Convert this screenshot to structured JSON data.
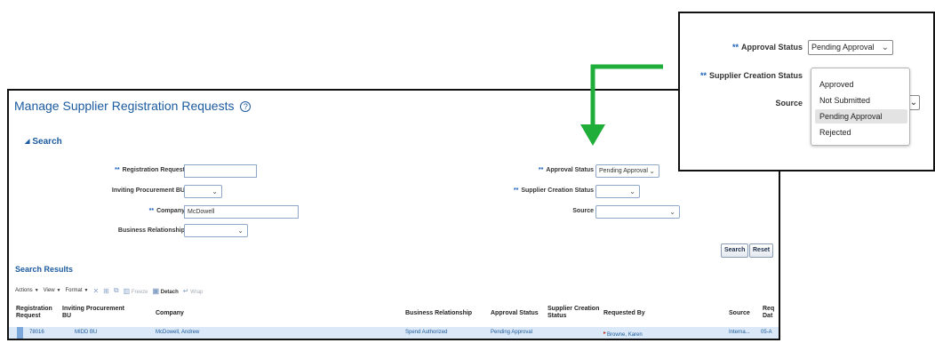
{
  "page": {
    "title": "Manage Supplier Registration Requests",
    "help_glyph": "?"
  },
  "search": {
    "header": "Search",
    "required_marker": "**",
    "fields": {
      "registration_request": {
        "label": "Registration Request",
        "value": ""
      },
      "inviting_bu": {
        "label": "Inviting Procurement BU",
        "value": ""
      },
      "company": {
        "label": "Company",
        "value": "McDowell"
      },
      "business_relationship": {
        "label": "Business Relationship",
        "value": ""
      },
      "approval_status": {
        "label": "Approval Status",
        "value": "Pending Approval"
      },
      "supplier_creation_status": {
        "label": "Supplier Creation Status",
        "value": ""
      },
      "source": {
        "label": "Source",
        "value": ""
      }
    },
    "buttons": {
      "search": "Search",
      "reset": "Reset"
    }
  },
  "results": {
    "header": "Search Results",
    "toolbar": {
      "actions": "Actions",
      "view": "View",
      "format": "Format",
      "freeze": "Freeze",
      "detach": "Detach",
      "wrap": "Wrap"
    },
    "columns": {
      "registration_request": "Registration Request",
      "inviting_bu": "Inviting Procurement BU",
      "company": "Company",
      "business_relationship": "Business Relationship",
      "approval_status": "Approval Status",
      "supplier_creation_status": "Supplier Creation Status",
      "requested_by": "Requested By",
      "source": "Source",
      "requested_date": "Req Dat"
    },
    "rows": [
      {
        "registration_request": "78016",
        "inviting_bu": "MIDD BU",
        "company": "McDowell, Andrew",
        "business_relationship": "Spend Authorized",
        "approval_status": "Pending Approval",
        "supplier_creation_status": "",
        "requested_by": "Browne, Karen",
        "source": "Interna...",
        "requested_date": "05-A"
      }
    ]
  },
  "popup": {
    "approval_status_label": "Approval Status",
    "approval_status_value": "Pending Approval",
    "supplier_creation_status_label": "Supplier Creation Status",
    "source_label": "Source",
    "options": [
      "Approved",
      "Not Submitted",
      "Pending Approval",
      "Rejected"
    ],
    "highlighted_option": "Pending Approval"
  },
  "colors": {
    "link_blue": "#1b5a9e",
    "required_blue": "#1b5fb8",
    "arrow_green": "#1fae3a",
    "selected_row": "#dbe8f7"
  }
}
